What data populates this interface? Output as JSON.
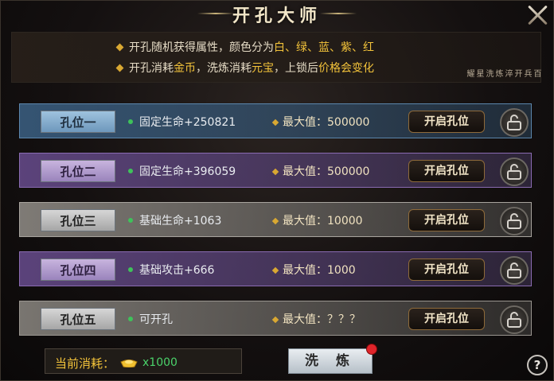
{
  "window": {
    "title": "开孔大师"
  },
  "info": {
    "line1_prefix": "开孔随机获得属性，颜色分为",
    "line1_colors": "白、绿、蓝、紫、红",
    "line2_a": "开孔消耗",
    "line2_gold": "金币",
    "line2_b": "，洗炼消耗",
    "line2_yuanbao": "元宝",
    "line2_c": "，上锁后",
    "line2_change": "价格会变化",
    "seal_text": "百兵开淬 炼洗星耀"
  },
  "slots": [
    {
      "label": "孔位一",
      "attr": "固定生命+250821",
      "max_label": "最大值：",
      "max_value": "500000",
      "button": "开启孔位",
      "quality": "blue"
    },
    {
      "label": "孔位二",
      "attr": "固定生命+396059",
      "max_label": "最大值：",
      "max_value": "500000",
      "button": "开启孔位",
      "quality": "purple"
    },
    {
      "label": "孔位三",
      "attr": "基础生命+1063",
      "max_label": "最大值：",
      "max_value": "10000",
      "button": "开启孔位",
      "quality": "gray"
    },
    {
      "label": "孔位四",
      "attr": "基础攻击+666",
      "max_label": "最大值：",
      "max_value": "1000",
      "button": "开启孔位",
      "quality": "purple"
    },
    {
      "label": "孔位五",
      "attr": "可开孔",
      "max_label": "最大值：",
      "max_value": "？？？",
      "button": "开启孔位",
      "quality": "gray"
    }
  ],
  "footer": {
    "cost_label": "当前消耗：",
    "cost_value": "x1000",
    "refine_button": "洗 炼",
    "help": "?"
  },
  "colors": {
    "gold": "#f2c23a",
    "green": "#4ad26a",
    "red_badge": "#e0242a"
  }
}
